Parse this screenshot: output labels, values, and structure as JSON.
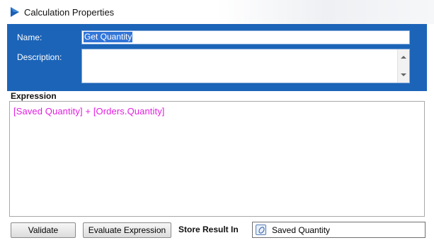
{
  "window": {
    "title": "Calculation Properties",
    "title_icon": "blue-arrow-icon"
  },
  "properties": {
    "name_label": "Name:",
    "name_value": "Get Quantity",
    "description_label": "Description:",
    "description_value": "",
    "panel_color": "#1c64b8"
  },
  "expression": {
    "header": "Expression",
    "text": "[Saved Quantity] + [Orders.Quantity]",
    "text_color": "#e31ee0"
  },
  "footer": {
    "validate_label": "Validate",
    "evaluate_label": "Evaluate Expression",
    "store_label": "Store Result In",
    "store_value": "Saved Quantity",
    "store_icon": "variable-icon"
  }
}
